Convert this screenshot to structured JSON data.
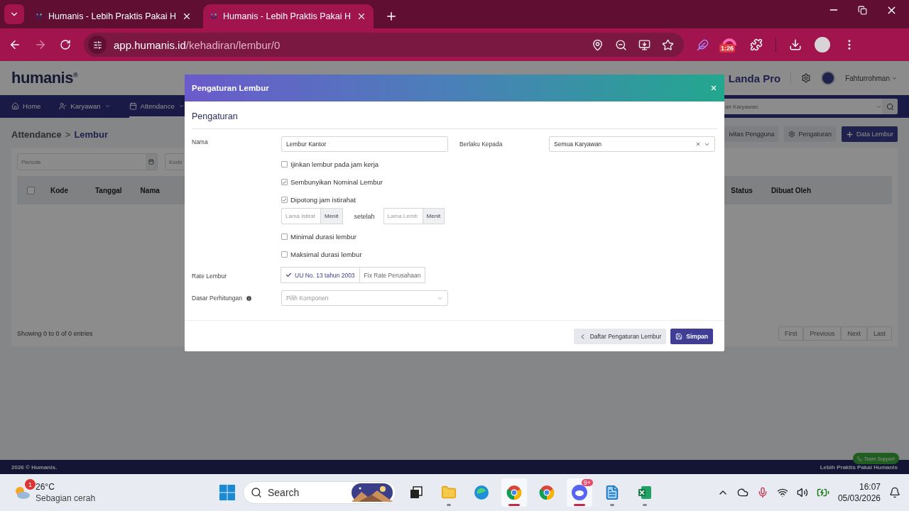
{
  "browser": {
    "tabs": [
      {
        "title": "Humanis - Lebih Praktis Pakai H",
        "selected": false
      },
      {
        "title": "Humanis - Lebih Praktis Pakai H",
        "selected": true
      }
    ],
    "url_host": "app.humanis.id",
    "url_path": "/kehadiran/lembur/0",
    "extension_badge": "1:26"
  },
  "header": {
    "logo": "humanis",
    "logo_mark": "®",
    "company": "Landa Pro",
    "user": "Fahturrohman"
  },
  "nav": {
    "items": [
      {
        "label": "Home",
        "dropdown": false,
        "selected": false
      },
      {
        "label": "Karyawan",
        "dropdown": true,
        "selected": false
      },
      {
        "label": "Attendance",
        "dropdown": true,
        "selected": true
      }
    ],
    "search_placeholder": "ari Karyawan"
  },
  "breadcrumb": {
    "parent": "Attendance",
    "separator": ">",
    "current": "Lembur"
  },
  "actions": [
    {
      "label": "ivitas Pengguna",
      "kind": "plain"
    },
    {
      "label": "Pengaturan",
      "kind": "settings"
    },
    {
      "label": "Data Lembur",
      "kind": "add"
    }
  ],
  "filters": [
    {
      "placeholder": "Periode",
      "kind": "date"
    },
    {
      "placeholder": "Kode",
      "kind": "text"
    }
  ],
  "table": {
    "select_all_checked": false,
    "columns": [
      "Kode",
      "Tanggal",
      "Nama",
      "Status",
      "Dibuat Oleh"
    ],
    "info": "Showing 0 to 0 of 0 entries",
    "pagination": [
      "First",
      "Previous",
      "Next",
      "Last"
    ]
  },
  "footer": {
    "copyright": "2026 © Humanis.",
    "tagline": "Lebih Praktis Pakai Humanis",
    "support": "Team Support"
  },
  "modal": {
    "title": "Pengaturan Lembur",
    "section": "Pengaturan",
    "nama": {
      "label": "Nama",
      "value": "Lembur Kantor"
    },
    "berlaku": {
      "label": "Berlaku Kepada",
      "value": "Semua Karyawan"
    },
    "options": [
      {
        "label": "Ijinkan lembur pada jam kerja",
        "checked": false
      },
      {
        "label": "Sembunyikan Nominal Lembur",
        "checked": true
      },
      {
        "label": "Dipotong jam istirahat",
        "checked": true
      }
    ],
    "break_inputs": {
      "first_placeholder": "Lama Istirat",
      "first_unit": "Menit",
      "connector": "setelah",
      "second_placeholder": "Lama Lemb",
      "second_unit": "Menit"
    },
    "duration_options": [
      {
        "label": "Minimal durasi lembur",
        "checked": false
      },
      {
        "label": "Maksimal durasi lembur",
        "checked": false
      }
    ],
    "rate": {
      "label": "Rate Lembur",
      "options": [
        {
          "label": "UU No. 13 tahun 2003",
          "selected": true
        },
        {
          "label": "Fix Rate Perusahaan",
          "selected": false
        }
      ]
    },
    "dasar": {
      "label": "Dasar Perhitungan",
      "placeholder": "Pilih Komponen"
    },
    "buttons": [
      {
        "label": "Daftar Pengaturan Lembur",
        "kind": "back"
      },
      {
        "label": "Simpan",
        "kind": "save"
      }
    ]
  },
  "taskbar": {
    "weather": {
      "temp": "26°C",
      "desc": "Sebagian cerah",
      "badge": "1"
    },
    "search": "Search",
    "apps": [
      {
        "kind": "taskview",
        "running": false,
        "active": false
      },
      {
        "kind": "explorer",
        "running": true,
        "active": false
      },
      {
        "kind": "edge",
        "running": false,
        "active": false
      },
      {
        "kind": "chrome",
        "running": true,
        "active": true
      },
      {
        "kind": "chrome",
        "running": false,
        "active": false
      },
      {
        "kind": "chat",
        "running": true,
        "active": true,
        "badge": "9+"
      },
      {
        "kind": "notepad",
        "running": true,
        "active": false
      },
      {
        "kind": "sheet",
        "running": true,
        "active": false
      }
    ],
    "time": "16:07",
    "date": "05/03/2026"
  }
}
